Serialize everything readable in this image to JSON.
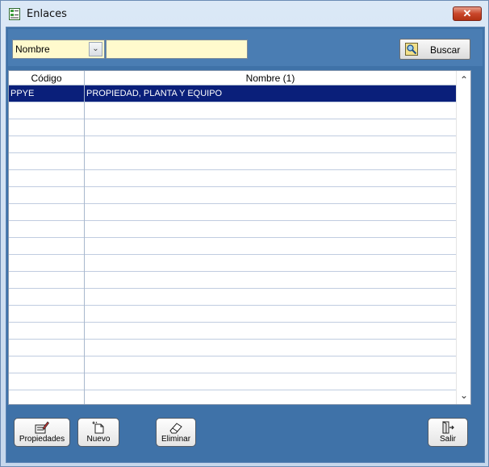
{
  "window": {
    "title": "Enlaces",
    "close_label": "✕"
  },
  "search": {
    "field_selected": "Nombre",
    "query_value": "",
    "buscar_label": "Buscar"
  },
  "grid": {
    "headers": [
      "Código",
      "Nombre (1)"
    ],
    "rows": [
      {
        "codigo": "PPYE",
        "nombre": "PROPIEDAD, PLANTA Y EQUIPO",
        "selected": true
      }
    ]
  },
  "toolbar": {
    "propiedades_label": "Propiedades",
    "nuevo_label": "Nuevo",
    "eliminar_label": "Eliminar",
    "salir_label": "Salir"
  },
  "colors": {
    "frame": "#3f72a8",
    "selection": "#0a1f7a",
    "input_bg": "#fffacd"
  }
}
